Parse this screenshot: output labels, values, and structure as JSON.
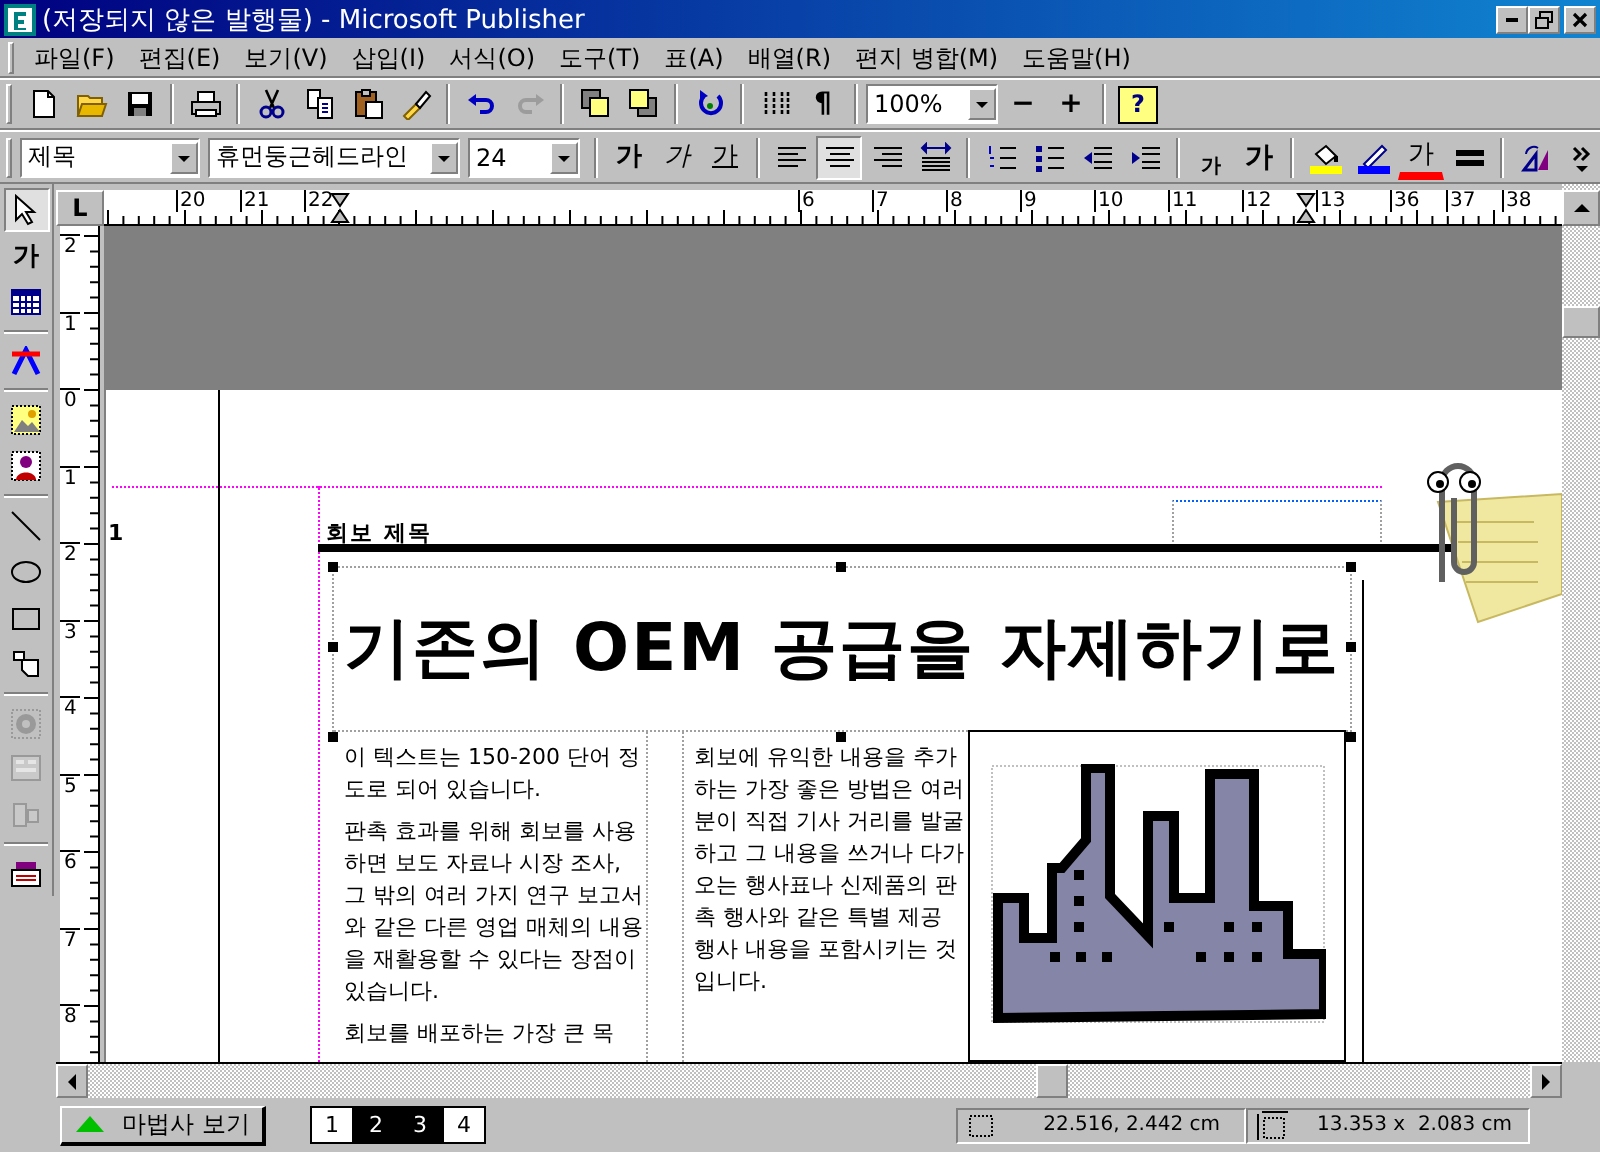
{
  "window": {
    "title": "(저장되지 않은 발행물) - Microsoft Publisher"
  },
  "menu": [
    {
      "label": "파일(F)"
    },
    {
      "label": "편집(E)"
    },
    {
      "label": "보기(V)"
    },
    {
      "label": "삽입(I)"
    },
    {
      "label": "서식(O)"
    },
    {
      "label": "도구(T)"
    },
    {
      "label": "표(A)"
    },
    {
      "label": "배열(R)"
    },
    {
      "label": "편지 병합(M)"
    },
    {
      "label": "도움말(H)"
    }
  ],
  "standard_toolbar": [
    {
      "kind": "new"
    },
    {
      "kind": "open"
    },
    {
      "kind": "save"
    },
    {
      "kind": "separator"
    },
    {
      "kind": "print"
    },
    {
      "kind": "separator"
    },
    {
      "kind": "cut"
    },
    {
      "kind": "copy"
    },
    {
      "kind": "paste"
    },
    {
      "kind": "painter"
    },
    {
      "kind": "separator"
    },
    {
      "kind": "undo",
      "disabled": false
    },
    {
      "kind": "redo",
      "disabled": true
    },
    {
      "kind": "separator"
    },
    {
      "kind": "front"
    },
    {
      "kind": "back"
    },
    {
      "kind": "separator"
    },
    {
      "kind": "rotate"
    },
    {
      "kind": "separator"
    },
    {
      "kind": "columns"
    },
    {
      "kind": "text",
      "label": "¶"
    },
    {
      "kind": "separator"
    },
    {
      "kind": "zoom",
      "value": "100%"
    },
    {
      "kind": "text",
      "label": "−"
    },
    {
      "kind": "text",
      "label": "+"
    },
    {
      "kind": "separator"
    },
    {
      "kind": "help",
      "label": "?"
    }
  ],
  "format_toolbar": [
    {
      "kind": "combo",
      "value": "제목"
    },
    {
      "kind": "combo",
      "value": "휴먼둥근헤드라인"
    },
    {
      "kind": "combo",
      "value": "24"
    },
    {
      "kind": "separator"
    },
    {
      "kind": "bold",
      "label": "가"
    },
    {
      "kind": "italic",
      "label": "가"
    },
    {
      "kind": "underline",
      "label": "가"
    },
    {
      "kind": "separator"
    },
    {
      "kind": "align-left",
      "selected": false
    },
    {
      "kind": "align-center",
      "selected": true
    },
    {
      "kind": "align-right",
      "selected": false
    },
    {
      "kind": "distribute",
      "selected": false
    },
    {
      "kind": "separator"
    },
    {
      "kind": "numbering"
    },
    {
      "kind": "bullets"
    },
    {
      "kind": "outdent"
    },
    {
      "kind": "indent"
    },
    {
      "kind": "separator"
    },
    {
      "kind": "shrink",
      "label": "가"
    },
    {
      "kind": "grow",
      "label": "가"
    },
    {
      "kind": "separator"
    },
    {
      "kind": "fill"
    },
    {
      "kind": "line-color"
    },
    {
      "kind": "font-color",
      "label": "가"
    },
    {
      "kind": "line-style"
    },
    {
      "kind": "separator"
    },
    {
      "kind": "rotate-flip"
    },
    {
      "kind": "overflow"
    }
  ],
  "toolbox": [
    {
      "kind": "pointer",
      "selected": true,
      "disabled": false
    },
    {
      "kind": "text",
      "label": "가",
      "selected": false,
      "disabled": false
    },
    {
      "kind": "table",
      "selected": false,
      "disabled": false
    },
    {
      "kind": "separator"
    },
    {
      "kind": "wordart",
      "selected": false,
      "disabled": false
    },
    {
      "kind": "separator"
    },
    {
      "kind": "picture",
      "selected": false,
      "disabled": false
    },
    {
      "kind": "clipart",
      "selected": false,
      "disabled": false
    },
    {
      "kind": "separator"
    },
    {
      "kind": "line",
      "selected": false,
      "disabled": false
    },
    {
      "kind": "oval",
      "selected": false,
      "disabled": false
    },
    {
      "kind": "rect",
      "selected": false,
      "disabled": false
    },
    {
      "kind": "shapes",
      "selected": false,
      "disabled": false
    },
    {
      "kind": "separator"
    },
    {
      "kind": "object",
      "selected": false,
      "disabled": true
    },
    {
      "kind": "form",
      "selected": false,
      "disabled": true
    },
    {
      "kind": "hotspot",
      "selected": false,
      "disabled": true
    },
    {
      "kind": "separator"
    },
    {
      "kind": "gallery",
      "selected": false,
      "disabled": false
    }
  ],
  "rulers": {
    "corner": "L",
    "horizontal_groups": [
      [
        "20",
        "21",
        "22"
      ],
      [
        "6",
        "7",
        "8",
        "9",
        "10",
        "11",
        "12",
        "13"
      ],
      [
        "36",
        "37",
        "38"
      ]
    ],
    "vertical": [
      "2",
      "1",
      "0",
      "1",
      "2",
      "3",
      "4",
      "5",
      "6",
      "7",
      "8"
    ]
  },
  "page": {
    "page_marker": "1",
    "header": "회보 제목",
    "headline": "기존의 OEM 공급을 자제하기로",
    "columns": [
      {
        "paragraphs": [
          "이 텍스트는 150-200 단어 정도로 되어 있습니다.",
          "판촉 효과를 위해 회보를 사용하면 보도 자료나 시장 조사, 그 밖의 여러 가지 연구 보고서와 같은 다른 영업 매체의 내용을 재활용할 수 있다는 장점이 있습니다.",
          "회보를 배포하는 가장 큰 목"
        ]
      },
      {
        "paragraphs": [
          "회보에 유익한 내용을 추가하는 가장 좋은 방법은 여러분이 직접 기사 거리를 발굴하고 그 내용을 쓰거나 다가오는 행사표나 신제품의 판촉 행사와 같은 특별 제공 행사 내용을 포함시키는 것입니다."
        ]
      }
    ]
  },
  "status_bar": {
    "wizard_button": "마법사 보기",
    "pages": [
      {
        "label": "1",
        "selected": false
      },
      {
        "label": "2",
        "selected": true
      },
      {
        "label": "3",
        "selected": true
      },
      {
        "label": "4",
        "selected": false
      }
    ],
    "position": "22.516, 2.442 cm",
    "size": "13.353 x  2.083 cm"
  }
}
